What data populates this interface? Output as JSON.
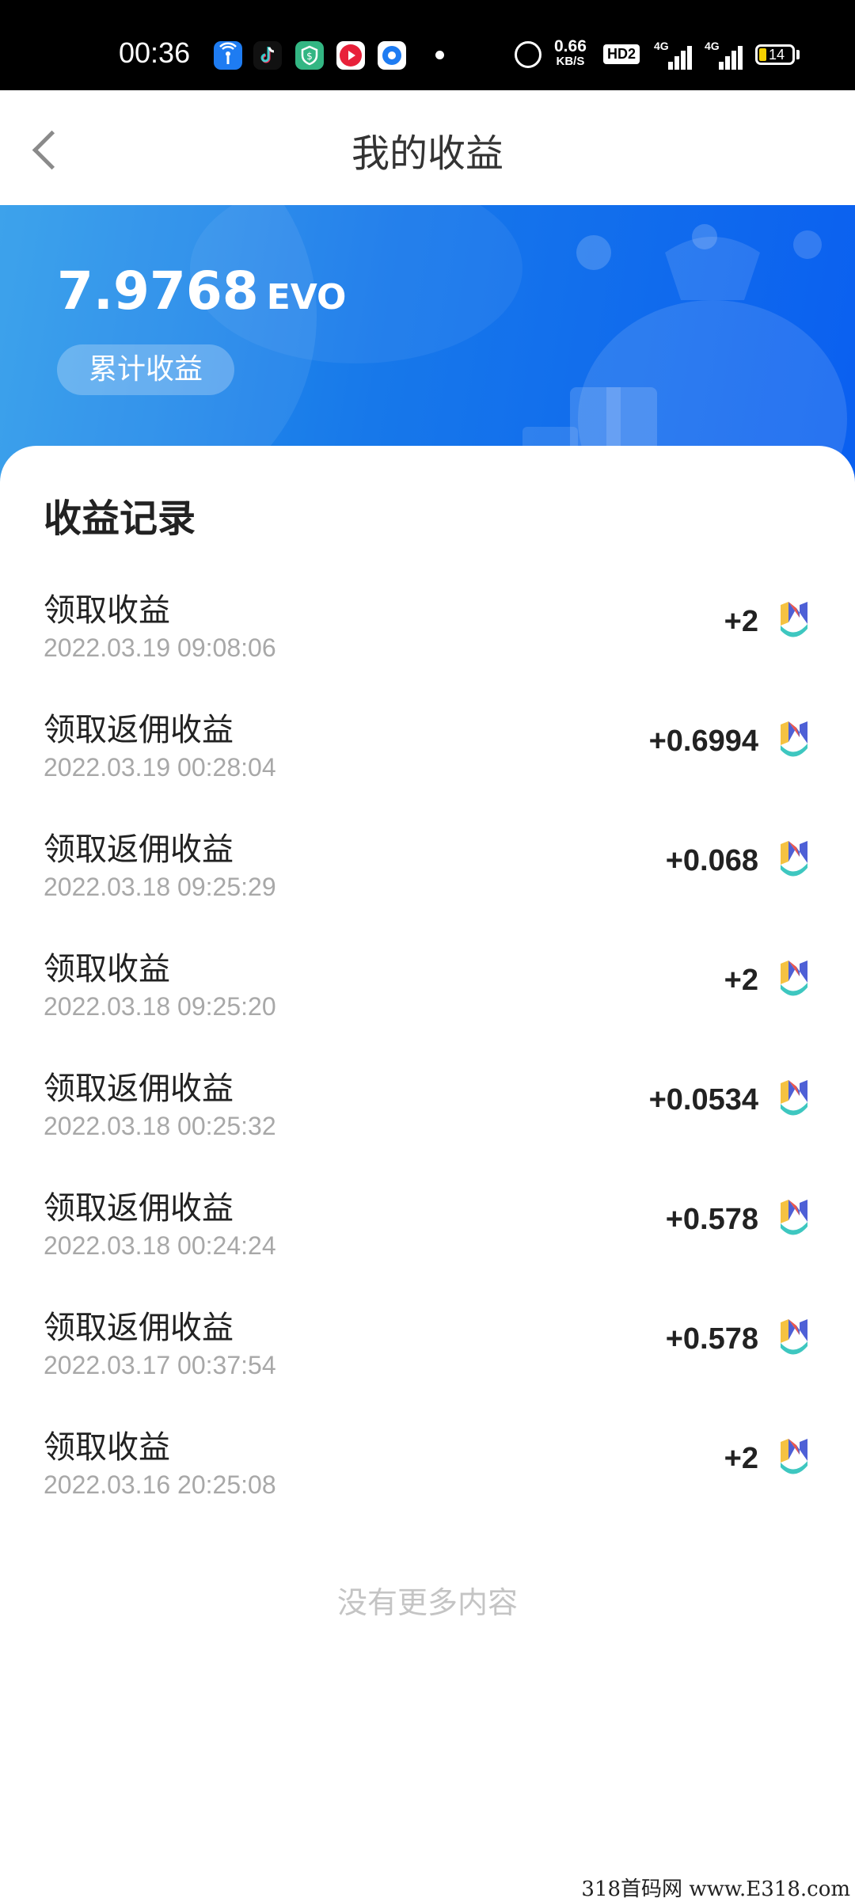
{
  "status_bar": {
    "time": "00:36",
    "speed_value": "0.66",
    "speed_unit": "KB/S",
    "hd_label": "HD2",
    "signal1_label": "4G",
    "signal2_label": "4G",
    "battery": "14",
    "app_icons": [
      {
        "name": "wifi-hotspot-app-icon",
        "color": "#1e7cf2"
      },
      {
        "name": "tiktok-app-icon",
        "color": "#111111"
      },
      {
        "name": "green-shield-app-icon",
        "color": "#33b683"
      },
      {
        "name": "red-play-app-icon",
        "color": "#e8213a"
      },
      {
        "name": "blue-circle-app-icon",
        "color": "#ffffff"
      }
    ]
  },
  "header": {
    "title": "我的收益"
  },
  "banner": {
    "amount": "7.9768",
    "unit": "EVO",
    "badge_label": "累计收益",
    "gradient_start": "#2d9bea",
    "gradient_end": "#0a5ff0"
  },
  "records": {
    "section_title": "收益记录",
    "items": [
      {
        "label": "领取收益",
        "date": "2022.03.19 09:08:06",
        "amount": "+2"
      },
      {
        "label": "领取返佣收益",
        "date": "2022.03.19 00:28:04",
        "amount": "+0.6994"
      },
      {
        "label": "领取返佣收益",
        "date": "2022.03.18 09:25:29",
        "amount": "+0.068"
      },
      {
        "label": "领取收益",
        "date": "2022.03.18 09:25:20",
        "amount": "+2"
      },
      {
        "label": "领取返佣收益",
        "date": "2022.03.18 00:25:32",
        "amount": "+0.0534"
      },
      {
        "label": "领取返佣收益",
        "date": "2022.03.18 00:24:24",
        "amount": "+0.578"
      },
      {
        "label": "领取返佣收益",
        "date": "2022.03.17 00:37:54",
        "amount": "+0.578"
      },
      {
        "label": "领取收益",
        "date": "2022.03.16 20:25:08",
        "amount": "+2"
      }
    ],
    "coin_icon": "evo-token-icon",
    "no_more": "没有更多内容"
  },
  "watermark": "318首码网 www.E318.com"
}
